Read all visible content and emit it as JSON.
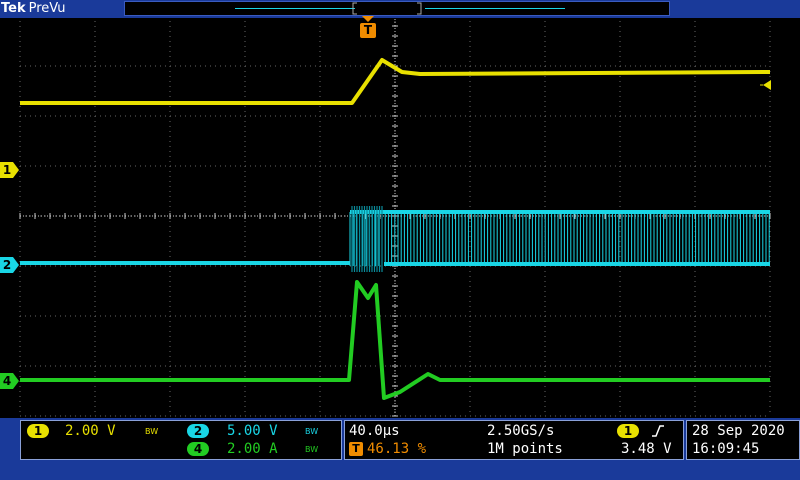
{
  "header": {
    "brand": "Tek",
    "mode": "PreVu",
    "trigger_flag": "T"
  },
  "colors": {
    "ch1": "#e8e000",
    "ch2": "#19d6e6",
    "ch4": "#22cc22",
    "accent": "#f08c00",
    "ui": "#1a3a9a"
  },
  "markers": {
    "ch1": "1",
    "ch2": "2",
    "ch4": "4"
  },
  "channels": [
    {
      "id": "1",
      "scale": "2.00 V",
      "bw": "BW"
    },
    {
      "id": "2",
      "scale": "5.00 V",
      "bw": "BW"
    },
    {
      "id": "4",
      "scale": "2.00 A",
      "bw": "BW"
    }
  ],
  "timebase": {
    "scale": "40.0µs",
    "sample_rate": "2.50GS/s",
    "trigger_pos": "46.13 %",
    "record_length": "1M points",
    "trigger_source": "1",
    "trigger_level": "3.48 V"
  },
  "clock": {
    "date": "28 Sep  2020",
    "time": "16:09:45"
  }
}
